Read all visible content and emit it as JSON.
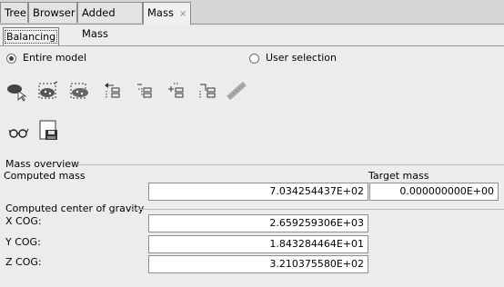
{
  "tabs": [
    {
      "label": "Tree"
    },
    {
      "label": "Browser"
    },
    {
      "label": "Added Mass"
    },
    {
      "label": "Mass",
      "close": "×"
    }
  ],
  "subtab": {
    "label": "Balancing"
  },
  "radios": {
    "entire_model": "Entire model",
    "user_selection": "User selection",
    "selected": "entire_model"
  },
  "toolbar_icons": [
    "select-elements-icon",
    "select-box-icon",
    "select-region-icon",
    "align-x-icon",
    "align-y-icon",
    "align-z-icon",
    "align-ref-icon",
    "spring-icon"
  ],
  "toolbar2_icons": [
    "view-glasses-icon",
    "save-icon"
  ],
  "mass_overview": {
    "title": "Mass overview",
    "computed_mass_label": "Computed mass",
    "computed_mass_value": "7.034254437E+02",
    "target_mass_label": "Target mass",
    "target_mass_value": "0.000000000E+00"
  },
  "cog": {
    "title": "Computed center of gravity",
    "x_label": "X COG:",
    "x_value": "2.659259306E+03",
    "y_label": "Y COG:",
    "y_value": "1.843284464E+01",
    "z_label": "Z COG:",
    "z_value": "3.210375580E+02"
  }
}
